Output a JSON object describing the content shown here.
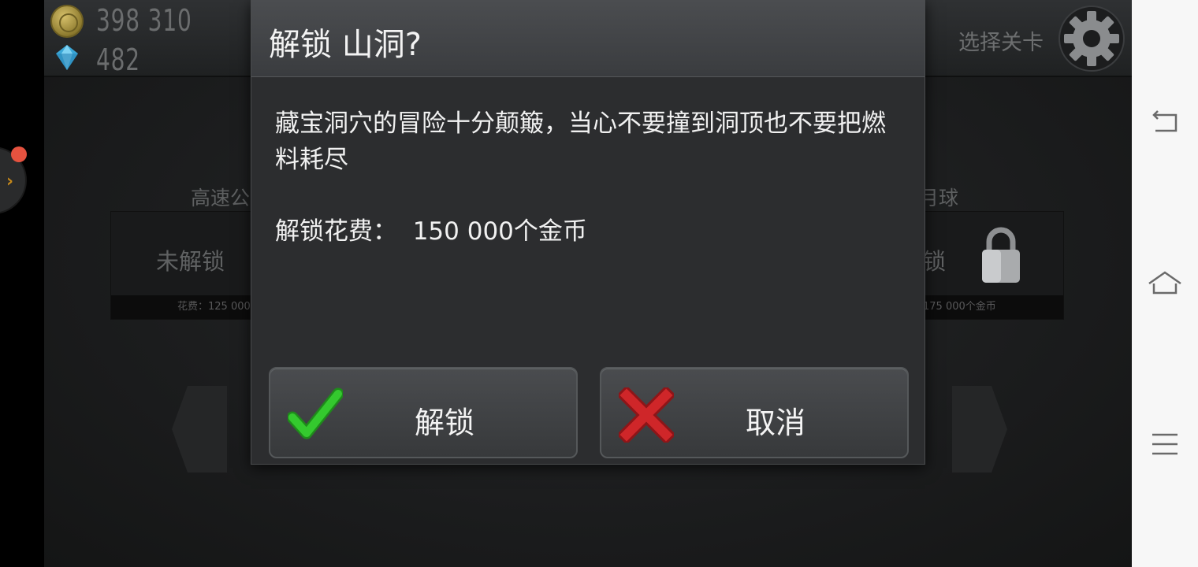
{
  "currency": {
    "coins": "398 310",
    "gems": "482"
  },
  "header": {
    "select_level": "选择关卡"
  },
  "levels": {
    "left": {
      "name": "高速公",
      "status": "未解锁",
      "cost": "花费：125 000"
    },
    "right": {
      "name": "月球",
      "status": "锁",
      "cost": "175 000个金币"
    }
  },
  "dialog": {
    "title": "解锁 山洞?",
    "description": "藏宝洞穴的冒险十分颠簸，当心不要撞到洞顶也不要把燃料耗尽",
    "cost": "解锁花费：  150 000个金币",
    "unlock_button": "解锁",
    "cancel_button": "取消"
  },
  "colors": {
    "confirm": "#2fbf2a",
    "cancel": "#c8262a"
  },
  "icons": {
    "coin": "coin-icon",
    "gem": "diamond-icon",
    "settings": "gear-icon",
    "lock": "padlock-icon",
    "confirm": "checkmark-icon",
    "cancel": "cross-icon",
    "nav_back": "back-icon",
    "nav_home": "home-icon",
    "nav_menu": "menu-icon"
  }
}
